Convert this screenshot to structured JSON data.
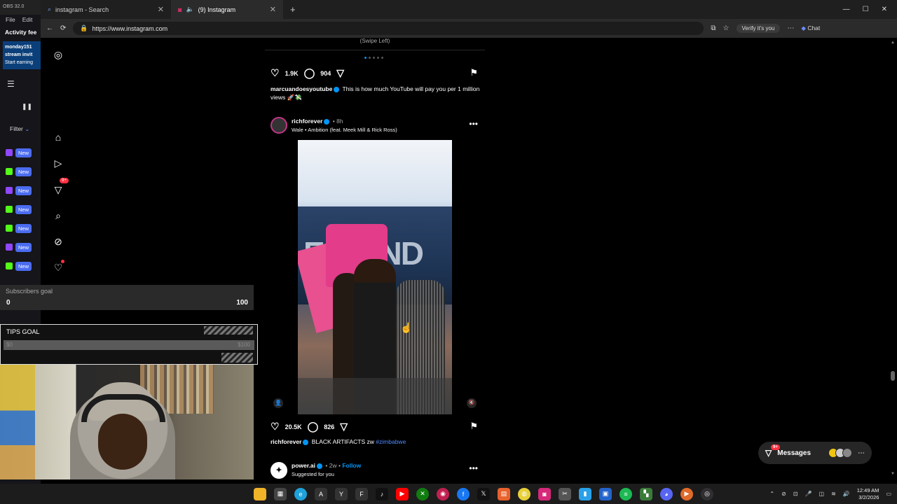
{
  "browser": {
    "tabs": [
      {
        "label": "instagram - Search"
      },
      {
        "label": "(9) Instagram"
      }
    ],
    "url": "https://www.instagram.com",
    "verify_label": "Verify it's you",
    "chat_label": "Chat"
  },
  "obs": {
    "title": "OBS 32.0",
    "menu_file": "File",
    "menu_edit": "Edit",
    "activity_label": "Activity fee",
    "promo_line1": "monday151",
    "promo_line2": "stream invit",
    "promo_line3": "Start earning",
    "filter_label": "Filter",
    "new_badge": "New"
  },
  "ig_nav": {
    "notif_count": "9+"
  },
  "overlays": {
    "subs_label": "Subscribers goal",
    "subs_min": "0",
    "subs_max": "100",
    "tips_label": "TIPS GOAL",
    "tips_min": "$0",
    "tips_max": "$100"
  },
  "feed": {
    "swipe_hint": "(Swipe Left)",
    "post1": {
      "likes": "1.9K",
      "comments": "904",
      "user": "marcuandoesyoutube",
      "caption": "This is how much YouTube will pay you per 1 million views 🚀💸"
    },
    "post2": {
      "user": "richforever",
      "time": "8h",
      "song": "Wale • Ambition (feat. Meek Mill & Rick Ross)",
      "likes": "20.5K",
      "comments": "826",
      "caption": "BLACK ARTIFACTS zw",
      "hashtag": "#zimbabwe"
    },
    "post3": {
      "user": "power.ai",
      "time": "2w",
      "follow_label": "Follow",
      "subtitle": "Suggested for you"
    }
  },
  "messages": {
    "label": "Messages",
    "badge": "9+"
  },
  "taskbar": {
    "time": "12:49 AM",
    "date": "3/2/2026"
  }
}
